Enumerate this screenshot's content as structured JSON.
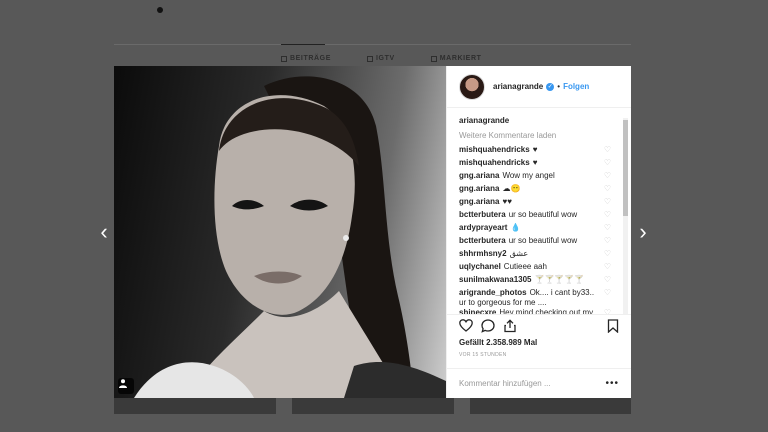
{
  "background": {
    "tabs": [
      {
        "label": "BEITRÄGE"
      },
      {
        "label": "IGTV"
      },
      {
        "label": "MARKIERT"
      }
    ]
  },
  "post": {
    "username": "arianagrande",
    "follow_label": "Folgen",
    "caption_username": "arianagrande",
    "load_more": "Weitere Kommentare laden",
    "comments": [
      {
        "user": "mishquahendricks",
        "text": "♥"
      },
      {
        "user": "mishquahendricks",
        "text": "♥"
      },
      {
        "user": "gng.ariana",
        "text": "Wow my angel"
      },
      {
        "user": "gng.ariana",
        "text": "☁😶"
      },
      {
        "user": "gng.ariana",
        "text": "♥♥"
      },
      {
        "user": "bctterbutera",
        "text": "ur so beautiful wow"
      },
      {
        "user": "ardyprayeart",
        "text": "💧"
      },
      {
        "user": "bctterbutera",
        "text": "ur so beautiful wow"
      },
      {
        "user": "shhrmhsny2",
        "text": "عشق"
      },
      {
        "user": "uqlychanel",
        "text": "Cutieee aah"
      },
      {
        "user": "sunilmakwana1305",
        "text": "🍸🍸🍸🍸🍸"
      },
      {
        "user": "arigrande_photos",
        "text": "Ok.... i cant by33.. ur to gorgeous for me ...."
      },
      {
        "user": "shinecxre",
        "text": "Hey mind checking out my"
      }
    ],
    "likes": "Gefällt 2.358.989 Mal",
    "time": "VOR 15 STUNDEN",
    "comment_placeholder": "Kommentar hinzufügen ...",
    "more_label": "•••"
  },
  "icons": {
    "prev": "‹",
    "next": "›",
    "heart": "♡"
  },
  "colors": {
    "accent": "#3897f0",
    "overlay": "#585858"
  }
}
